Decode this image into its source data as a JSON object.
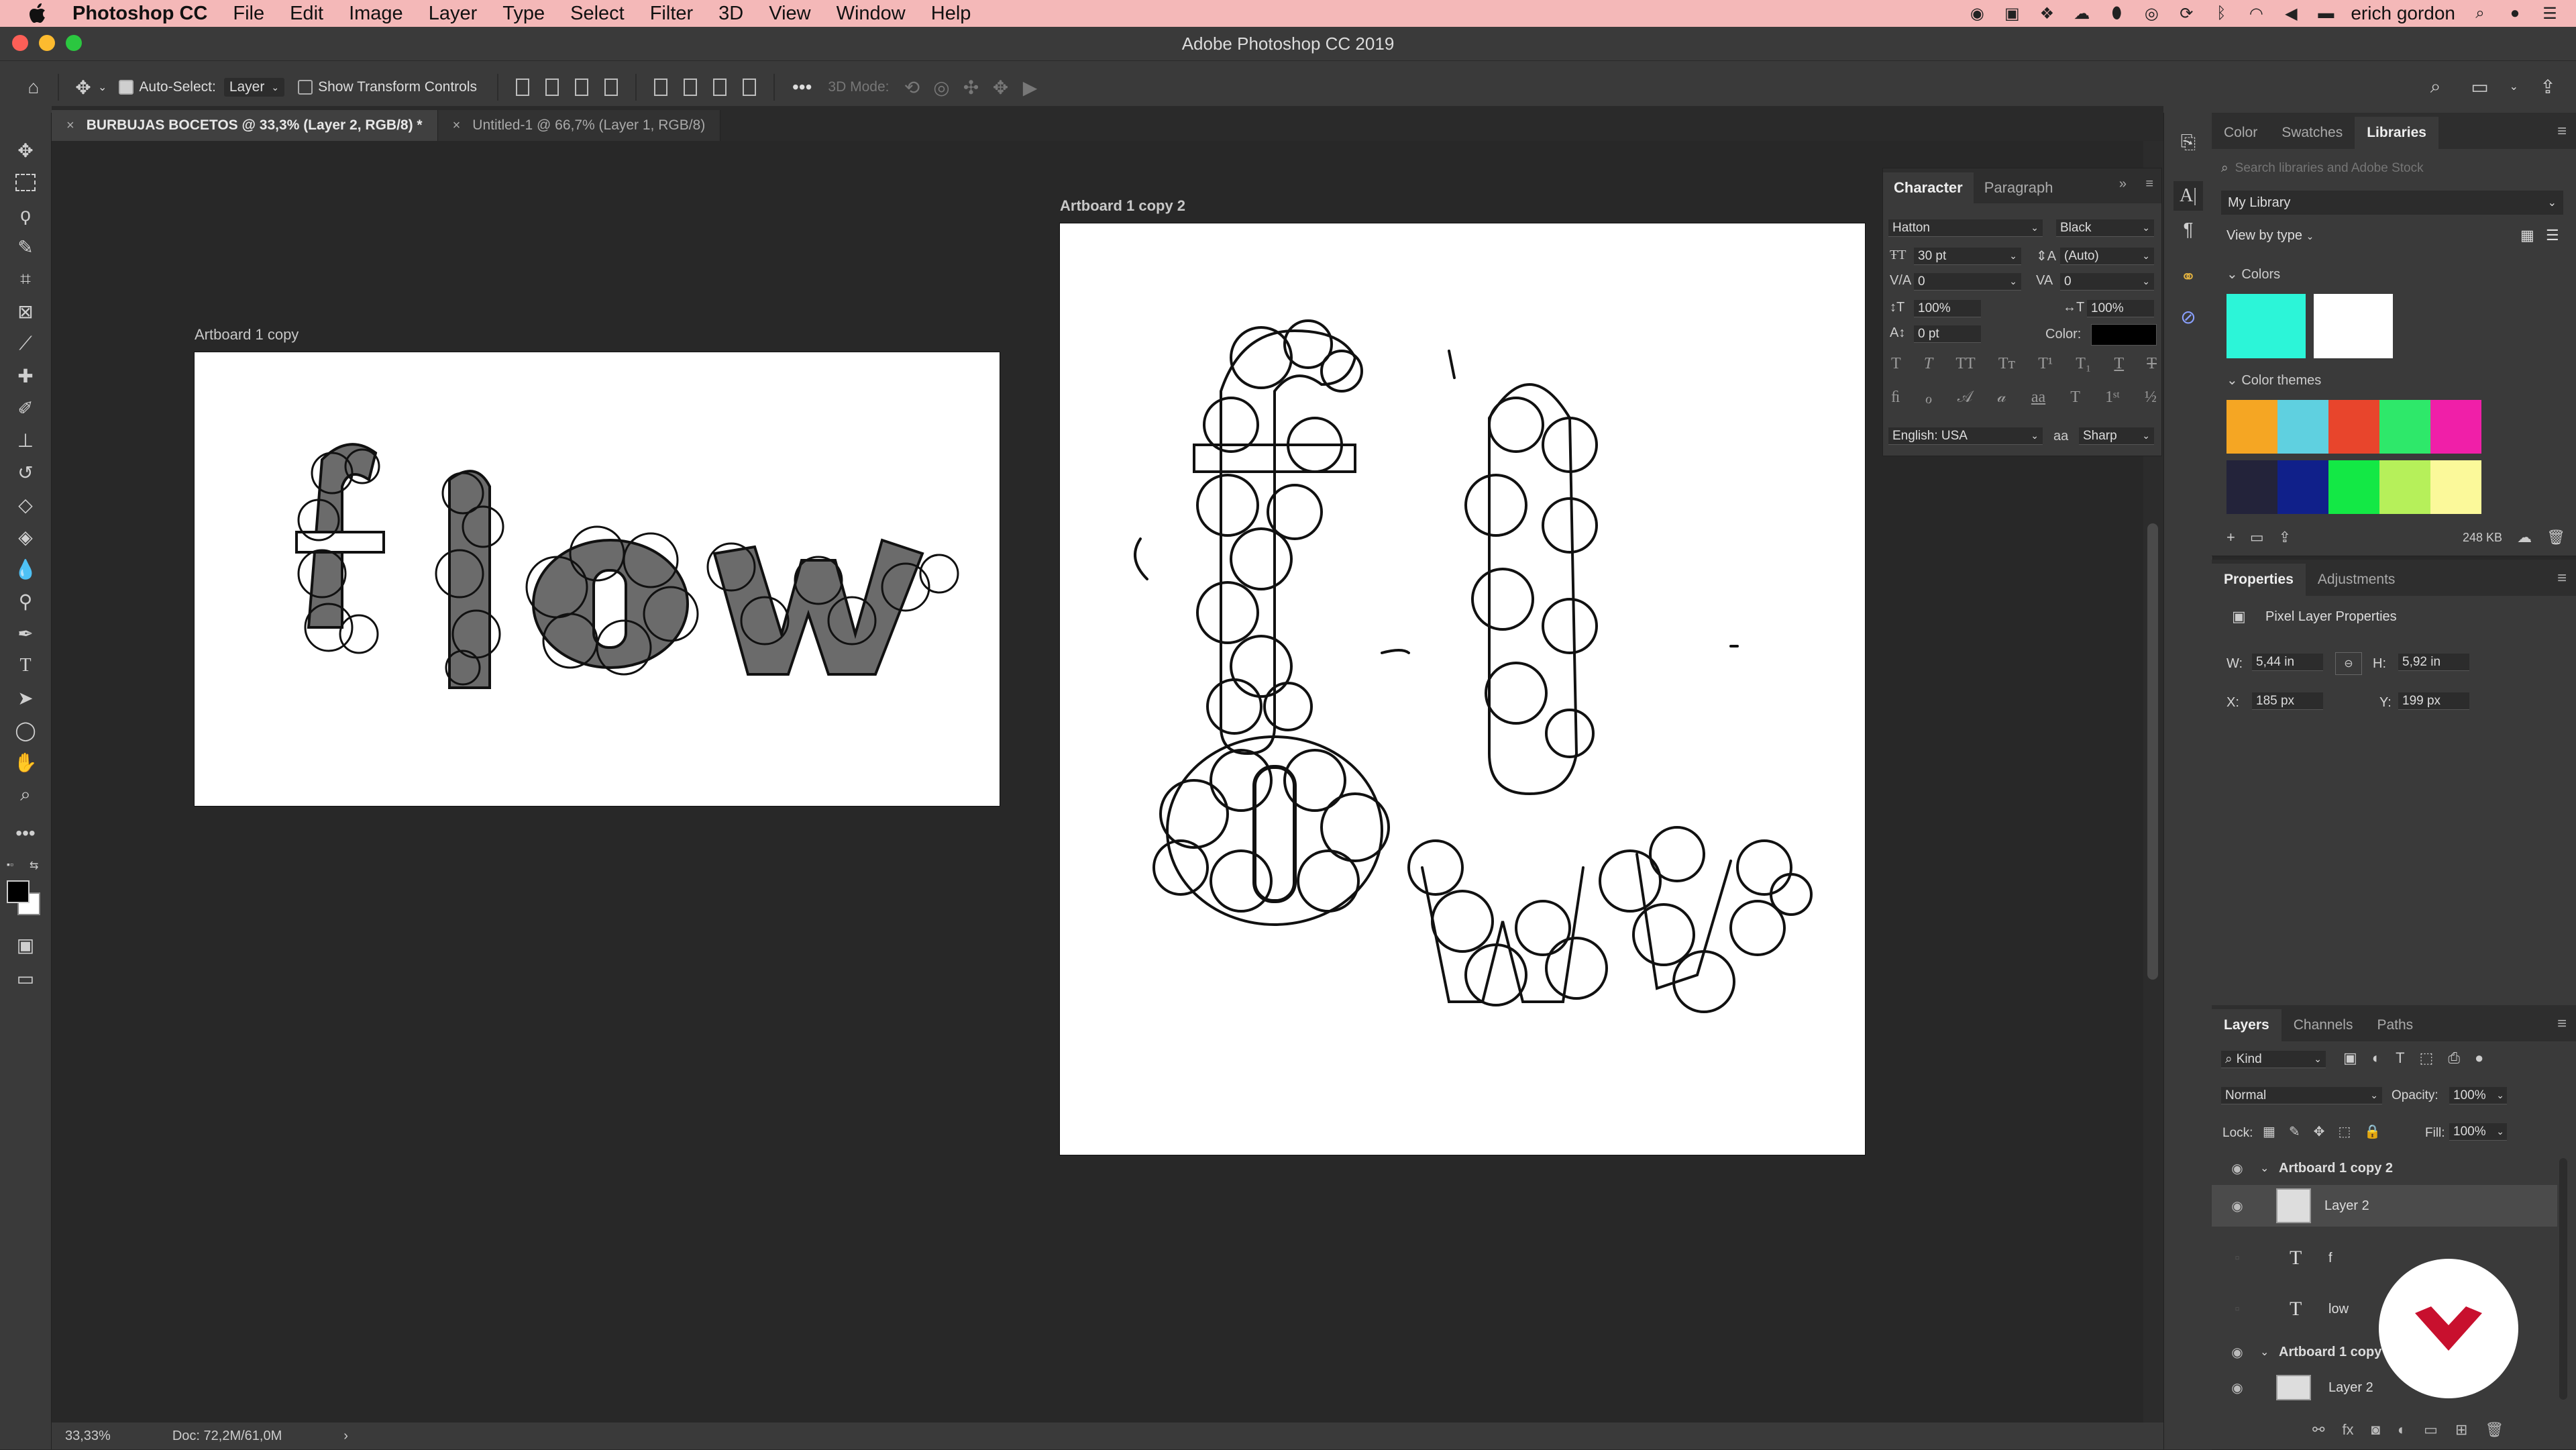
{
  "menubar": {
    "app_name": "Photoshop CC",
    "items": [
      "File",
      "Edit",
      "Image",
      "Layer",
      "Type",
      "Select",
      "Filter",
      "3D",
      "View",
      "Window",
      "Help"
    ],
    "user": "erich gordon"
  },
  "window": {
    "title": "Adobe Photoshop CC 2019"
  },
  "options": {
    "auto_select_label": "Auto-Select:",
    "auto_select_value": "Layer",
    "transform_label": "Show Transform Controls",
    "mode_3d_label": "3D Mode:"
  },
  "doc_tabs": [
    {
      "label": "BURBUJAS BOCETOS @ 33,3% (Layer 2, RGB/8) *"
    },
    {
      "label": "Untitled-1 @ 66,7% (Layer 1, RGB/8)"
    }
  ],
  "artboards": {
    "small_label": "Artboard 1 copy",
    "large_label": "Artboard 1 copy 2"
  },
  "status": {
    "zoom": "33,33%",
    "doc": "Doc: 72,2M/61,0M"
  },
  "character": {
    "tabs": [
      "Character",
      "Paragraph"
    ],
    "font_family": "Hatton",
    "font_style": "Black",
    "size": "30 pt",
    "leading": "(Auto)",
    "kerning": "0",
    "tracking": "0",
    "vscale": "100%",
    "hscale": "100%",
    "baseline": "0 pt",
    "color_label": "Color:",
    "language": "English: USA",
    "antialias": "Sharp",
    "aa_label": "aa"
  },
  "libraries": {
    "tabs": [
      "Color",
      "Swatches",
      "Libraries"
    ],
    "search_placeholder": "Search libraries and Adobe Stock",
    "library": "My Library",
    "view_by": "View by type",
    "colors_heading": "Colors",
    "themes_heading": "Color themes",
    "size": "248 KB",
    "colors": [
      "#2cf5d8",
      "#ffffff"
    ],
    "theme1": [
      "#f5a623",
      "#5fd0e0",
      "#e8452c",
      "#2ee86a",
      "#f01fa8"
    ],
    "theme2": [
      "#23233a",
      "#10208a",
      "#13e845",
      "#b6f05a",
      "#fbf99a"
    ]
  },
  "properties": {
    "tabs": [
      "Properties",
      "Adjustments"
    ],
    "title": "Pixel Layer Properties",
    "w_label": "W:",
    "w": "5,44 in",
    "h_label": "H:",
    "h": "5,92 in",
    "x_label": "X:",
    "x": "185 px",
    "y_label": "Y:",
    "y": "199 px"
  },
  "layers": {
    "tabs": [
      "Layers",
      "Channels",
      "Paths"
    ],
    "filter": "Kind",
    "blend": "Normal",
    "opacity_label": "Opacity:",
    "opacity": "100%",
    "lock_label": "Lock:",
    "fill_label": "Fill:",
    "fill": "100%",
    "rows": [
      {
        "name": "Artboard 1 copy 2"
      },
      {
        "name": "Layer 2"
      },
      {
        "name": "f"
      },
      {
        "name": "low"
      },
      {
        "name": "Artboard 1 copy"
      },
      {
        "name": "Layer 2"
      }
    ],
    "type_glyph": "T"
  }
}
